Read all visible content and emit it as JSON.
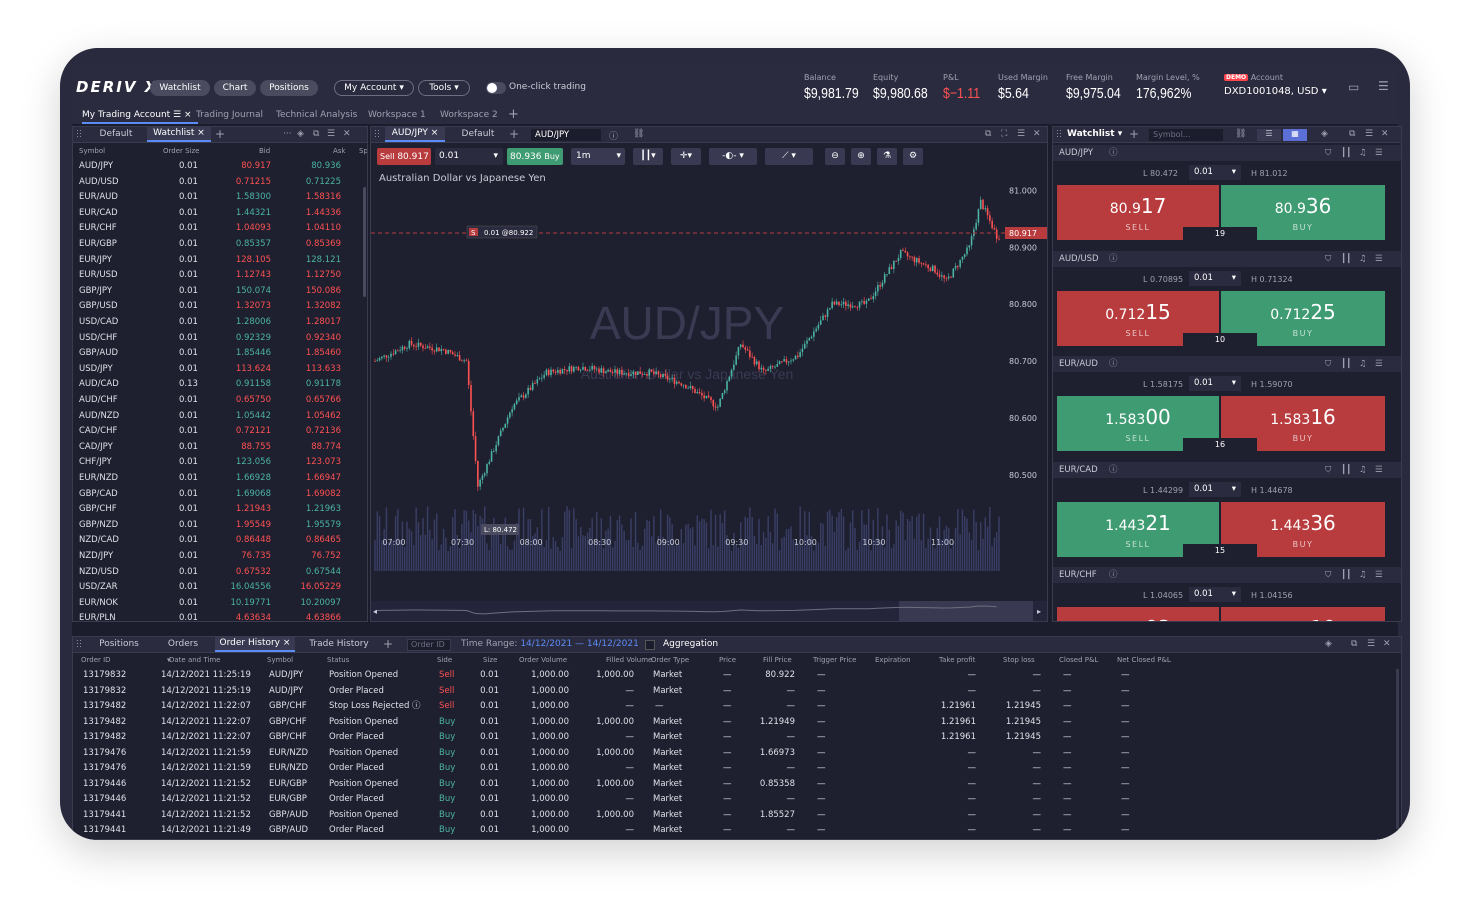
{
  "brand": "DERIV X",
  "top_buttons": {
    "watchlist": "Watchlist",
    "chart": "Chart",
    "positions": "Positions",
    "account": "My Account",
    "tools": "Tools"
  },
  "one_click": "One-click trading",
  "stats": [
    {
      "label": "Balance",
      "value": "$9,981.79"
    },
    {
      "label": "Equity",
      "value": "$9,980.68"
    },
    {
      "label": "P&L",
      "value": "$−1.11"
    },
    {
      "label": "Used Margin",
      "value": "$5.64"
    },
    {
      "label": "Free Margin",
      "value": "$9,975.04"
    },
    {
      "label": "Margin Level, %",
      "value": "176,962%"
    }
  ],
  "account": {
    "badge": "DEMO",
    "label": "Account",
    "id": "DXD1001048, USD"
  },
  "workspace_tabs": [
    "My Trading Account",
    "Trading Journal",
    "Technical Analysis",
    "Workspace 1",
    "Workspace 2"
  ],
  "left_watchlist": {
    "tabs": [
      "Default",
      "Watchlist"
    ],
    "headers": {
      "symbol": "Symbol",
      "size": "Order Size",
      "bid": "Bid",
      "ask": "Ask",
      "sp": "Sp"
    },
    "rows": [
      {
        "s": "AUD/JPY",
        "z": "0.01",
        "b": "80.917",
        "a": "80.936",
        "bd": "dn",
        "ad": "up"
      },
      {
        "s": "AUD/USD",
        "z": "0.01",
        "b": "0.71215",
        "a": "0.71225",
        "bd": "dn",
        "ad": "up"
      },
      {
        "s": "EUR/AUD",
        "z": "0.01",
        "b": "1.58300",
        "a": "1.58316",
        "bd": "up",
        "ad": "dn"
      },
      {
        "s": "EUR/CAD",
        "z": "0.01",
        "b": "1.44321",
        "a": "1.44336",
        "bd": "up",
        "ad": "dn"
      },
      {
        "s": "EUR/CHF",
        "z": "0.01",
        "b": "1.04093",
        "a": "1.04110",
        "bd": "dn",
        "ad": "dn"
      },
      {
        "s": "EUR/GBP",
        "z": "0.01",
        "b": "0.85357",
        "a": "0.85369",
        "bd": "up",
        "ad": "dn"
      },
      {
        "s": "EUR/JPY",
        "z": "0.01",
        "b": "128.105",
        "a": "128.121",
        "bd": "dn",
        "ad": "up"
      },
      {
        "s": "EUR/USD",
        "z": "0.01",
        "b": "1.12743",
        "a": "1.12750",
        "bd": "dn",
        "ad": "dn"
      },
      {
        "s": "GBP/JPY",
        "z": "0.01",
        "b": "150.074",
        "a": "150.086",
        "bd": "up",
        "ad": "dn"
      },
      {
        "s": "GBP/USD",
        "z": "0.01",
        "b": "1.32073",
        "a": "1.32082",
        "bd": "dn",
        "ad": "dn"
      },
      {
        "s": "USD/CAD",
        "z": "0.01",
        "b": "1.28006",
        "a": "1.28017",
        "bd": "up",
        "ad": "dn"
      },
      {
        "s": "USD/CHF",
        "z": "0.01",
        "b": "0.92329",
        "a": "0.92340",
        "bd": "up",
        "ad": "dn"
      },
      {
        "s": "GBP/AUD",
        "z": "0.01",
        "b": "1.85446",
        "a": "1.85460",
        "bd": "up",
        "ad": "dn"
      },
      {
        "s": "USD/JPY",
        "z": "0.01",
        "b": "113.624",
        "a": "113.633",
        "bd": "dn",
        "ad": "dn"
      },
      {
        "s": "AUD/CAD",
        "z": "0.13",
        "b": "0.91158",
        "a": "0.91178",
        "bd": "up",
        "ad": "up"
      },
      {
        "s": "AUD/CHF",
        "z": "0.01",
        "b": "0.65750",
        "a": "0.65766",
        "bd": "dn",
        "ad": "dn"
      },
      {
        "s": "AUD/NZD",
        "z": "0.01",
        "b": "1.05442",
        "a": "1.05462",
        "bd": "up",
        "ad": "dn"
      },
      {
        "s": "CAD/CHF",
        "z": "0.01",
        "b": "0.72121",
        "a": "0.72136",
        "bd": "dn",
        "ad": "dn"
      },
      {
        "s": "CAD/JPY",
        "z": "0.01",
        "b": "88.755",
        "a": "88.774",
        "bd": "dn",
        "ad": "dn"
      },
      {
        "s": "CHF/JPY",
        "z": "0.01",
        "b": "123.056",
        "a": "123.073",
        "bd": "up",
        "ad": "dn"
      },
      {
        "s": "EUR/NZD",
        "z": "0.01",
        "b": "1.66928",
        "a": "1.66947",
        "bd": "up",
        "ad": "dn"
      },
      {
        "s": "GBP/CAD",
        "z": "0.01",
        "b": "1.69068",
        "a": "1.69082",
        "bd": "up",
        "ad": "dn"
      },
      {
        "s": "GBP/CHF",
        "z": "0.01",
        "b": "1.21943",
        "a": "1.21963",
        "bd": "dn",
        "ad": "up"
      },
      {
        "s": "GBP/NZD",
        "z": "0.01",
        "b": "1.95549",
        "a": "1.95579",
        "bd": "dn",
        "ad": "up"
      },
      {
        "s": "NZD/CAD",
        "z": "0.01",
        "b": "0.86448",
        "a": "0.86465",
        "bd": "dn",
        "ad": "dn"
      },
      {
        "s": "NZD/JPY",
        "z": "0.01",
        "b": "76.735",
        "a": "76.752",
        "bd": "dn",
        "ad": "dn"
      },
      {
        "s": "NZD/USD",
        "z": "0.01",
        "b": "0.67532",
        "a": "0.67544",
        "bd": "dn",
        "ad": "up"
      },
      {
        "s": "USD/ZAR",
        "z": "0.01",
        "b": "16.04556",
        "a": "16.05229",
        "bd": "up",
        "ad": "dn"
      },
      {
        "s": "EUR/NOK",
        "z": "0.01",
        "b": "10.19771",
        "a": "10.20097",
        "bd": "up",
        "ad": "up"
      },
      {
        "s": "EUR/PLN",
        "z": "0.01",
        "b": "4.63634",
        "a": "4.63866",
        "bd": "dn",
        "ad": "dn"
      }
    ]
  },
  "chart": {
    "tabs": [
      "AUD/JPY",
      "Default"
    ],
    "symbol_input": "AUD/JPY",
    "sell_label": "Sell",
    "sell_price": "80.917",
    "qty": "0.01",
    "buy_price": "80.936",
    "buy_label": "Buy",
    "interval": "1m",
    "title": "Australian Dollar vs Japanese Yen",
    "watermark": "AUD/JPY",
    "watermark_sub": "Australian Dollar vs Japanese Yen",
    "order_marker": "0.01 @80.922",
    "order_side": "S",
    "low_marker": "L: 80.472",
    "current_price": "80.917",
    "y_ticks": [
      "81.000",
      "80.900",
      "80.800",
      "80.700",
      "80.600",
      "80.500"
    ],
    "x_ticks": [
      "07:00",
      "07:30",
      "08:00",
      "08:30",
      "09:00",
      "09:30",
      "10:00",
      "10:30",
      "11:00"
    ]
  },
  "chart_data": {
    "type": "line",
    "title": "Australian Dollar vs Japanese Yen",
    "x": [
      "06:55",
      "07:10",
      "07:25",
      "07:35",
      "07:40",
      "07:55",
      "08:10",
      "08:25",
      "08:40",
      "08:55",
      "09:10",
      "09:25",
      "09:35",
      "09:45",
      "10:00",
      "10:15",
      "10:30",
      "10:45",
      "11:00",
      "11:05",
      "11:15",
      "11:20",
      "11:27"
    ],
    "series": [
      {
        "values": [
          80.7,
          80.73,
          80.72,
          80.7,
          80.48,
          80.62,
          80.68,
          80.69,
          80.68,
          80.68,
          80.66,
          80.62,
          80.73,
          80.68,
          80.71,
          80.8,
          80.8,
          80.89,
          80.86,
          80.84,
          80.9,
          80.98,
          80.92
        ]
      }
    ],
    "ylim": [
      80.44,
      81.02
    ]
  },
  "right_watchlist": {
    "title": "Watchlist",
    "search_placeholder": "Symbol...",
    "items": [
      {
        "sym": "AUD/JPY",
        "low": "L 80.472",
        "high": "H 81.012",
        "qty": "0.01",
        "sell_a": "80.9",
        "sell_b": "17",
        "buy_a": "80.9",
        "buy_b": "36",
        "spread": "19",
        "sell_color": "sell",
        "buy_color": "buy",
        "sell_lbl": "SELL",
        "buy_lbl": "BUY"
      },
      {
        "sym": "AUD/USD",
        "low": "L 0.70895",
        "high": "H 0.71324",
        "qty": "0.01",
        "sell_a": "0.712",
        "sell_b": "15",
        "buy_a": "0.712",
        "buy_b": "25",
        "spread": "10",
        "sell_color": "sell",
        "buy_color": "buy",
        "sell_lbl": "SELL",
        "buy_lbl": "BUY"
      },
      {
        "sym": "EUR/AUD",
        "low": "L 1.58175",
        "high": "H 1.59070",
        "qty": "0.01",
        "sell_a": "1.583",
        "sell_b": "00",
        "buy_a": "1.583",
        "buy_b": "16",
        "spread": "16",
        "sell_color": "buy",
        "buy_color": "sell",
        "sell_lbl": "SELL",
        "buy_lbl": "BUY"
      },
      {
        "sym": "EUR/CAD",
        "low": "L 1.44299",
        "high": "H 1.44678",
        "qty": "0.01",
        "sell_a": "1.443",
        "sell_b": "21",
        "buy_a": "1.443",
        "buy_b": "36",
        "spread": "15",
        "sell_color": "buy",
        "buy_color": "sell",
        "sell_lbl": "SELL",
        "buy_lbl": "BUY"
      },
      {
        "sym": "EUR/CHF",
        "low": "L 1.04065",
        "high": "H 1.04156",
        "qty": "0.01",
        "sell_a": "1.040",
        "sell_b": "93",
        "buy_a": "1.041",
        "buy_b": "10",
        "spread": "",
        "sell_color": "sell",
        "buy_color": "sell",
        "sell_lbl": "",
        "buy_lbl": ""
      }
    ]
  },
  "bottom": {
    "tabs": [
      "Positions",
      "Orders",
      "Order History",
      "Trade History"
    ],
    "order_id_placeholder": "Order ID",
    "time_range_label": "Time Range:",
    "time_range": "14/12/2021 — 14/12/2021",
    "aggregation": "Aggregation",
    "headers": [
      "Order ID",
      "Date and Time",
      "Symbol",
      "Status",
      "Side",
      "Size",
      "Order Volume",
      "Filled Volume",
      "Order Type",
      "Price",
      "Fill Price",
      "Trigger Price",
      "Expiration",
      "Take profit",
      "Stop loss",
      "Closed P&L",
      "Net Closed P&L"
    ],
    "rows": [
      [
        "13179832",
        "14/12/2021 11:25:19",
        "AUD/JPY",
        "Position Opened",
        "Sell",
        "0.01",
        "1,000.00",
        "1,000.00",
        "Market",
        "—",
        "80.922",
        "—",
        "",
        "—",
        "—",
        "—",
        "—"
      ],
      [
        "13179832",
        "14/12/2021 11:25:19",
        "AUD/JPY",
        "Order Placed",
        "Sell",
        "0.01",
        "1,000.00",
        "—",
        "Market",
        "—",
        "—",
        "—",
        "",
        "—",
        "—",
        "—",
        "—"
      ],
      [
        "13179482",
        "14/12/2021 11:22:07",
        "GBP/CHF",
        "Stop Loss Rejected ⓘ",
        "Sell",
        "0.01",
        "1,000.00",
        "—",
        "—",
        "—",
        "—",
        "—",
        "",
        "1.21961",
        "1.21945",
        "—",
        "—"
      ],
      [
        "13179482",
        "14/12/2021 11:22:07",
        "GBP/CHF",
        "Position Opened",
        "Buy",
        "0.01",
        "1,000.00",
        "1,000.00",
        "Market",
        "—",
        "1.21949",
        "—",
        "",
        "1.21961",
        "1.21945",
        "—",
        "—"
      ],
      [
        "13179482",
        "14/12/2021 11:22:07",
        "GBP/CHF",
        "Order Placed",
        "Buy",
        "0.01",
        "1,000.00",
        "—",
        "Market",
        "—",
        "—",
        "—",
        "",
        "1.21961",
        "1.21945",
        "—",
        "—"
      ],
      [
        "13179476",
        "14/12/2021 11:21:59",
        "EUR/NZD",
        "Position Opened",
        "Buy",
        "0.01",
        "1,000.00",
        "1,000.00",
        "Market",
        "—",
        "1.66973",
        "—",
        "",
        "—",
        "—",
        "—",
        "—"
      ],
      [
        "13179476",
        "14/12/2021 11:21:59",
        "EUR/NZD",
        "Order Placed",
        "Buy",
        "0.01",
        "1,000.00",
        "—",
        "Market",
        "—",
        "—",
        "—",
        "",
        "—",
        "—",
        "—",
        "—"
      ],
      [
        "13179446",
        "14/12/2021 11:21:52",
        "EUR/GBP",
        "Position Opened",
        "Buy",
        "0.01",
        "1,000.00",
        "1,000.00",
        "Market",
        "—",
        "0.85358",
        "—",
        "",
        "—",
        "—",
        "—",
        "—"
      ],
      [
        "13179446",
        "14/12/2021 11:21:52",
        "EUR/GBP",
        "Order Placed",
        "Buy",
        "0.01",
        "1,000.00",
        "—",
        "Market",
        "—",
        "—",
        "—",
        "",
        "—",
        "—",
        "—",
        "—"
      ],
      [
        "13179441",
        "14/12/2021 11:21:52",
        "GBP/AUD",
        "Position Opened",
        "Buy",
        "0.01",
        "1,000.00",
        "1,000.00",
        "Market",
        "—",
        "1.85527",
        "—",
        "",
        "—",
        "—",
        "—",
        "—"
      ],
      [
        "13179441",
        "14/12/2021 11:21:49",
        "GBP/AUD",
        "Order Placed",
        "Buy",
        "0.01",
        "1,000.00",
        "—",
        "Market",
        "—",
        "—",
        "—",
        "",
        "—",
        "—",
        "—",
        "—"
      ]
    ]
  },
  "colors": {
    "up": "#4bb4a4",
    "down": "#ff5252",
    "sell_bg": "#b83b3e",
    "buy_bg": "#3e9b72",
    "accent": "#5b8cf5"
  }
}
